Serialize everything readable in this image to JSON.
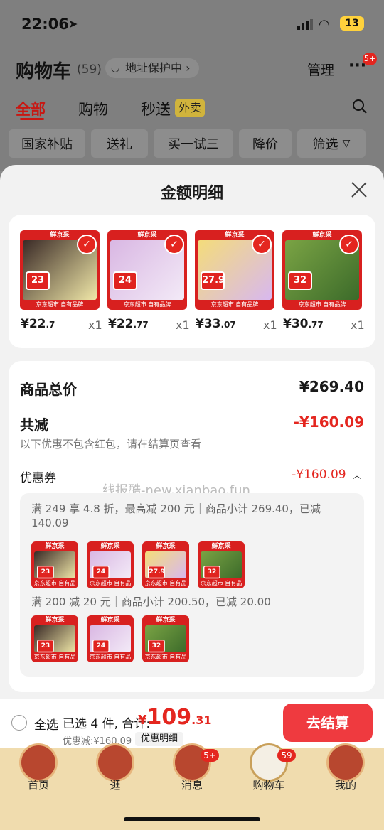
{
  "status_bar": {
    "time": "22:06",
    "battery": "13"
  },
  "header": {
    "title": "购物车",
    "count": "(59)",
    "address": "地址保护中 ›",
    "manage": "管理",
    "more_badge": "5+"
  },
  "tabs": [
    {
      "label": "全部"
    },
    {
      "label": "购物"
    },
    {
      "label": "秒送"
    }
  ],
  "tab_badge": "外卖",
  "filters": [
    "国家补贴",
    "送礼",
    "买一试三",
    "降价",
    "筛选"
  ],
  "sheet": {
    "title": "金额明细",
    "products": [
      {
        "price_int": "¥22",
        "price_dec": ".7",
        "qty": "x1",
        "tag": "23",
        "colors": [
          "#3a2a26",
          "#f0e7a8"
        ]
      },
      {
        "price_int": "¥22",
        "price_dec": ".77",
        "qty": "x1",
        "tag": "24",
        "colors": [
          "#d9b7e3",
          "#f3eaf7"
        ]
      },
      {
        "price_int": "¥33",
        "price_dec": ".07",
        "qty": "x1",
        "tag": "27.9",
        "colors": [
          "#f4dc7a",
          "#d8b8ef"
        ]
      },
      {
        "price_int": "¥30",
        "price_dec": ".77",
        "qty": "x1",
        "tag": "32",
        "colors": [
          "#7aa344",
          "#3c6b2a"
        ]
      }
    ],
    "brand_text": "鲜京采",
    "brand_footer": "京东超市 自有品牌",
    "total_label": "商品总价",
    "total_value": "¥269.40",
    "reduce_label": "共减",
    "reduce_value": "-¥160.09",
    "reduce_note": "以下优惠不包含红包，请在结算页查看",
    "coupon_label": "优惠券",
    "coupon_value": "-¥160.09",
    "watermark": "线报酷-new.xianbao.fun",
    "rule1": "满 249 享 4.8 折，最高减 200 元｜商品小计 269.40，已减 140.09",
    "rule2": "满 200 减 20 元｜商品小计 200.50，已减 20.00"
  },
  "checkout": {
    "select_all": "全选",
    "summary": "已选 4 件, 合计:",
    "total_symbol": "¥",
    "total_int": "109",
    "total_dec": ".31",
    "discount": "优惠减:¥160.09",
    "detail_btn": "优惠明细",
    "button": "去结算"
  },
  "bottom_nav": [
    {
      "label": "首页"
    },
    {
      "label": "逛"
    },
    {
      "label": "消息",
      "badge": "5+"
    },
    {
      "label": "购物车",
      "badge": "59"
    },
    {
      "label": "我的"
    }
  ]
}
